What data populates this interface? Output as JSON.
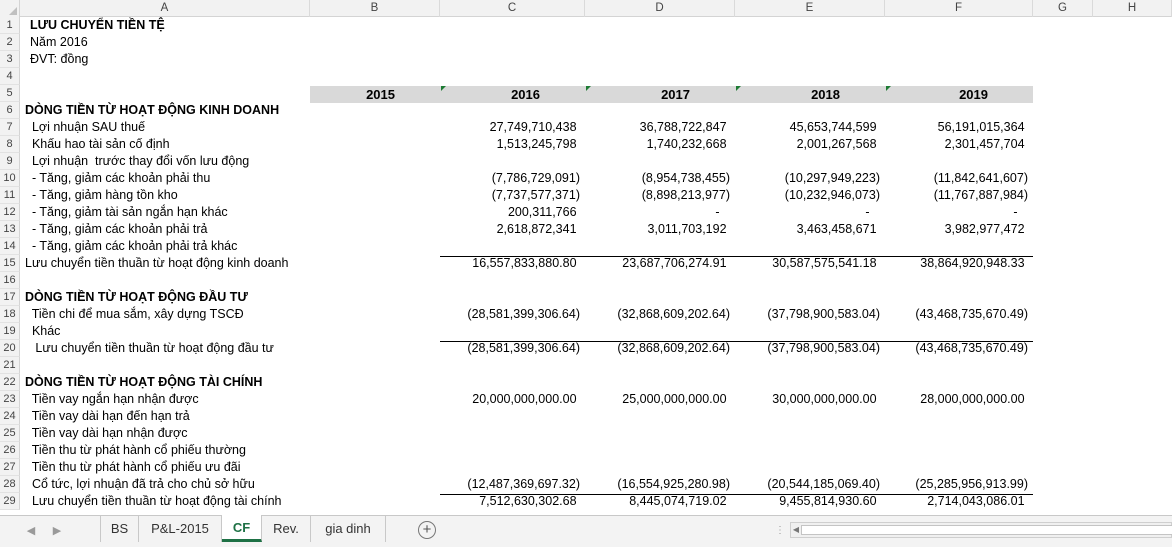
{
  "columns": [
    "A",
    "B",
    "C",
    "D",
    "E",
    "F",
    "G",
    "H"
  ],
  "title": "LƯU CHUYỂN TIỀN TỆ",
  "year_line": "Năm 2016",
  "unit_line": "ĐVT: đồng",
  "years": [
    "2015",
    "2016",
    "2017",
    "2018",
    "2019"
  ],
  "rows": [
    {
      "n": "1"
    },
    {
      "n": "2"
    },
    {
      "n": "3"
    },
    {
      "n": "4"
    },
    {
      "n": "5"
    },
    {
      "n": "6",
      "label": "DÒNG TIỀN TỪ HOẠT ĐỘNG KINH DOANH",
      "bold": true
    },
    {
      "n": "7",
      "label": "  Lợi nhuận SAU thuế",
      "c": "27,749,710,438 ",
      "d": "36,788,722,847 ",
      "e": "45,653,744,599 ",
      "f": "56,191,015,364 "
    },
    {
      "n": "8",
      "label": "  Khấu hao tài sản cố định",
      "c": "1,513,245,798 ",
      "d": "1,740,232,668 ",
      "e": "2,001,267,568 ",
      "f": "2,301,457,704 "
    },
    {
      "n": "9",
      "label": "  Lợi nhuận  trước thay đổi vốn lưu động"
    },
    {
      "n": "10",
      "label": "  - Tăng, giảm các khoản phải thu",
      "c": "(7,786,729,091)",
      "d": "(8,954,738,455)",
      "e": "(10,297,949,223)",
      "f": "(11,842,641,607)"
    },
    {
      "n": "11",
      "label": "  - Tăng, giảm hàng tồn kho",
      "c": "(7,737,577,371)",
      "d": "(8,898,213,977)",
      "e": "(10,232,946,073)",
      "f": "(11,767,887,984)"
    },
    {
      "n": "12",
      "label": "  - Tăng, giảm tài sản ngắn hạn khác",
      "c": "200,311,766 ",
      "d": "-   ",
      "e": "-   ",
      "f": "-   "
    },
    {
      "n": "13",
      "label": "  - Tăng, giảm các khoản phải trả",
      "c": "2,618,872,341 ",
      "d": "3,011,703,192 ",
      "e": "3,463,458,671 ",
      "f": "3,982,977,472 "
    },
    {
      "n": "14",
      "label": "  - Tăng, giảm các khoản phải trả khác"
    },
    {
      "n": "15",
      "label": "Lưu chuyển tiền thuần từ hoạt động kinh doanh",
      "c": "16,557,833,880.80 ",
      "d": "23,687,706,274.91 ",
      "e": "30,587,575,541.18 ",
      "f": "38,864,920,948.33 ",
      "line": true
    },
    {
      "n": "16"
    },
    {
      "n": "17",
      "label": "DÒNG TIỀN TỪ HOẠT ĐỘNG ĐẦU TƯ",
      "bold": true
    },
    {
      "n": "18",
      "label": "  Tiền chi để mua sắm, xây dựng TSCĐ",
      "c": "(28,581,399,306.64)",
      "d": "(32,868,609,202.64)",
      "e": "(37,798,900,583.04)",
      "f": "(43,468,735,670.49)"
    },
    {
      "n": "19",
      "label": "  Khác"
    },
    {
      "n": "20",
      "label": "   Lưu chuyển tiền thuần từ hoạt động đầu tư",
      "c": "(28,581,399,306.64)",
      "d": "(32,868,609,202.64)",
      "e": "(37,798,900,583.04)",
      "f": "(43,468,735,670.49)",
      "line": true
    },
    {
      "n": "21"
    },
    {
      "n": "22",
      "label": "DÒNG TIỀN TỪ HOẠT ĐỘNG TÀI CHÍNH",
      "bold": true
    },
    {
      "n": "23",
      "label": "  Tiền vay ngắn hạn nhận được",
      "c": "20,000,000,000.00 ",
      "d": "25,000,000,000.00 ",
      "e": "30,000,000,000.00 ",
      "f": "28,000,000,000.00 "
    },
    {
      "n": "24",
      "label": "  Tiền vay dài hạn đến hạn trả"
    },
    {
      "n": "25",
      "label": "  Tiền vay dài hạn nhận được"
    },
    {
      "n": "26",
      "label": "  Tiền thu từ phát hành cổ phiếu thường"
    },
    {
      "n": "27",
      "label": "  Tiền thu từ phát hành cổ phiếu ưu đãi"
    },
    {
      "n": "28",
      "label": "  Cổ tức, lợi nhuận đã trả cho chủ sở hữu",
      "c": "(12,487,369,697.32)",
      "d": "(16,554,925,280.98)",
      "e": "(20,544,185,069.40)",
      "f": "(25,285,956,913.99)"
    },
    {
      "n": "29",
      "label": "  Lưu chuyển tiền thuần từ hoạt động tài chính",
      "c": "7,512,630,302.68 ",
      "d": "8,445,074,719.02 ",
      "e": "9,455,814,930.60 ",
      "f": "2,714,043,086.01 ",
      "line": true
    }
  ],
  "tabs": [
    "BS",
    "P&L-2015",
    "CF",
    "Rev.",
    "gia dinh"
  ],
  "active_tab": "CF"
}
